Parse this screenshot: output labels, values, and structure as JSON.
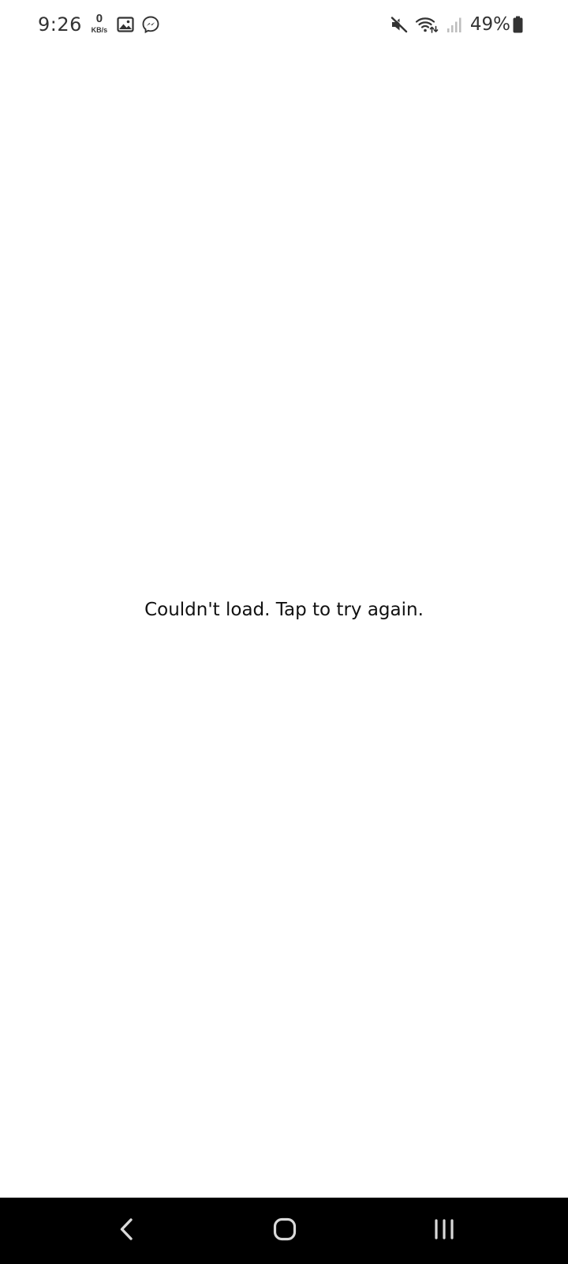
{
  "status_bar": {
    "time": "9:26",
    "net_speed_value": "0",
    "net_speed_unit": "KB/s",
    "notification_icons": [
      "gallery-icon",
      "messenger-icon"
    ],
    "system_icons": [
      "mute-icon",
      "wifi-icon",
      "signal-icon",
      "battery-icon"
    ],
    "battery_percent": "49%"
  },
  "main": {
    "message": "Couldn't load. Tap to try again."
  },
  "nav_bar": {
    "buttons": [
      "back-icon",
      "home-icon",
      "recents-icon"
    ]
  },
  "colors": {
    "background": "#ffffff",
    "text": "#111111",
    "status_icons": "#333333",
    "nav_bar": "#000000",
    "nav_icons": "#d9d9d9"
  }
}
